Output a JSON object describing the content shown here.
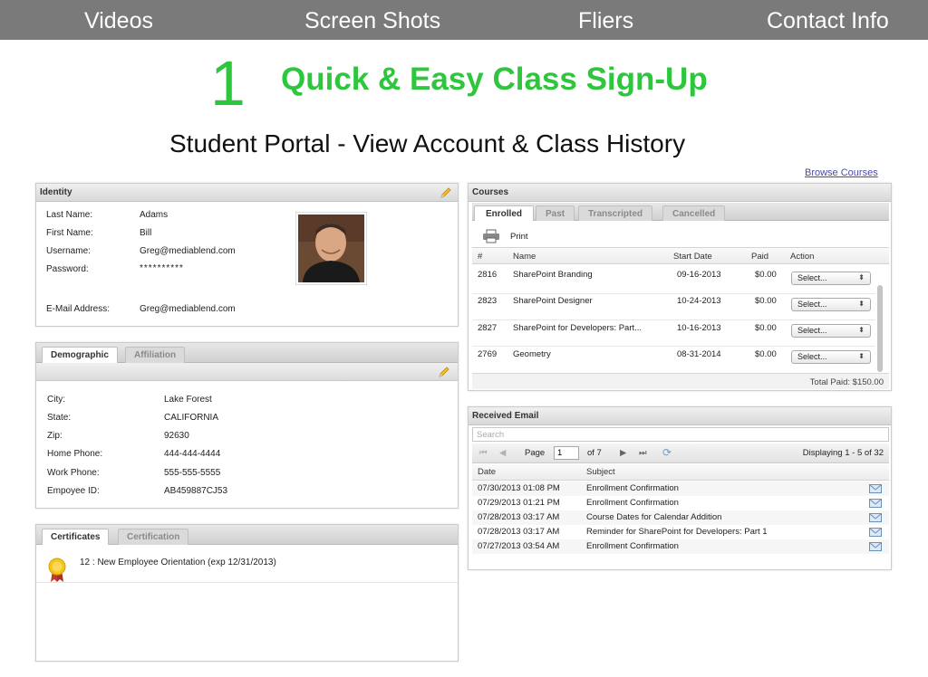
{
  "nav": {
    "items": [
      "Videos",
      "Screen Shots",
      "Fliers",
      "Contact Info"
    ]
  },
  "hero": {
    "step_number": "1",
    "headline": "Quick & Easy Class Sign-Up",
    "subheadline": "Student Portal - View Account & Class History"
  },
  "browse_link": "Browse Courses",
  "identity": {
    "title": "Identity",
    "fields": [
      {
        "label": "Last Name:",
        "value": "Adams"
      },
      {
        "label": "First Name:",
        "value": "Bill"
      },
      {
        "label": "Username:",
        "value": "Greg@mediablend.com"
      },
      {
        "label": "Password:",
        "value": "**********"
      },
      {
        "label": "E-Mail Address:",
        "value": "Greg@mediablend.com"
      }
    ]
  },
  "demographic": {
    "tabs": [
      "Demographic",
      "Affiliation"
    ],
    "fields": [
      {
        "label": "City:",
        "value": "Lake Forest"
      },
      {
        "label": "State:",
        "value": "CALIFORNIA"
      },
      {
        "label": "Zip:",
        "value": "92630"
      },
      {
        "label": "Home Phone:",
        "value": "444-444-4444"
      },
      {
        "label": "Work Phone:",
        "value": "555-555-5555"
      },
      {
        "label": "Empoyee ID:",
        "value": "AB459887CJ53"
      }
    ]
  },
  "certificates": {
    "tabs": [
      "Certificates",
      "Certification"
    ],
    "items": [
      "12 : New Employee Orientation (exp 12/31/2013)"
    ]
  },
  "courses": {
    "title": "Courses",
    "tabs": [
      "Enrolled",
      "Past",
      "Transcripted",
      "Cancelled"
    ],
    "print_label": "Print",
    "columns": [
      "#",
      "Name",
      "Start Date",
      "Paid",
      "Action"
    ],
    "rows": [
      {
        "id": "2816",
        "name": "SharePoint Branding",
        "start": "09-16-2013",
        "paid": "$0.00",
        "action": "Select..."
      },
      {
        "id": "2823",
        "name": "SharePoint Designer",
        "start": "10-24-2013",
        "paid": "$0.00",
        "action": "Select..."
      },
      {
        "id": "2827",
        "name": "SharePoint for Developers: Part...",
        "start": "10-16-2013",
        "paid": "$0.00",
        "action": "Select..."
      },
      {
        "id": "2769",
        "name": "Geometry",
        "start": "08-31-2014",
        "paid": "$0.00",
        "action": "Select..."
      }
    ],
    "total_paid": "Total Paid:  $150.00"
  },
  "email": {
    "title": "Received Email",
    "search_placeholder": "Search",
    "pager": {
      "page_label": "Page",
      "page_value": "1",
      "of_label": "of 7",
      "displaying": "Displaying 1 - 5 of 32"
    },
    "columns": [
      "Date",
      "Subject"
    ],
    "rows": [
      {
        "date": "07/30/2013 01:08 PM",
        "subject": "Enrollment Confirmation"
      },
      {
        "date": "07/29/2013 01:21 PM",
        "subject": "Enrollment Confirmation"
      },
      {
        "date": "07/28/2013 03:17 AM",
        "subject": "Course Dates for Calendar Addition"
      },
      {
        "date": "07/28/2013 03:17 AM",
        "subject": "Reminder for SharePoint for Developers: Part 1"
      },
      {
        "date": "07/27/2013 03:54 AM",
        "subject": "Enrollment Confirmation"
      }
    ]
  },
  "colors": {
    "nav_bg": "#7a7a7a",
    "accent_green": "#2ec63d",
    "link_blue": "#4a4aa8"
  }
}
